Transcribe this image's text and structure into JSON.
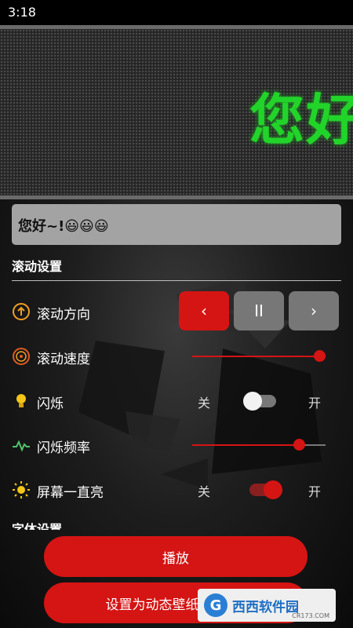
{
  "status_bar": {
    "time": "3:18"
  },
  "led": {
    "text": "您好~!"
  },
  "message_input": {
    "value": "您好~!😃😃😃"
  },
  "scroll_settings": {
    "title": "滚动设置",
    "direction": {
      "label": "滚动方向",
      "buttons": [
        "‹",
        "II",
        "›"
      ],
      "active": "left"
    },
    "speed": {
      "label": "滚动速度",
      "value": 0.95
    },
    "blink": {
      "label": "闪烁",
      "off_label": "关",
      "on_label": "开",
      "on": false
    },
    "blink_frequency": {
      "label": "闪烁频率",
      "value": 0.8
    },
    "screen_on": {
      "label": "屏幕一直亮",
      "off_label": "关",
      "on_label": "开",
      "on": true
    }
  },
  "font_settings": {
    "title": "字体设置"
  },
  "buttons": {
    "play": "播放",
    "set_wallpaper": "设置为动态壁纸"
  },
  "watermark": {
    "logo": "G",
    "text": "西西软件园",
    "url": "CR173.COM"
  },
  "colors": {
    "accent": "#d51414",
    "led_green": "#22d42a"
  }
}
